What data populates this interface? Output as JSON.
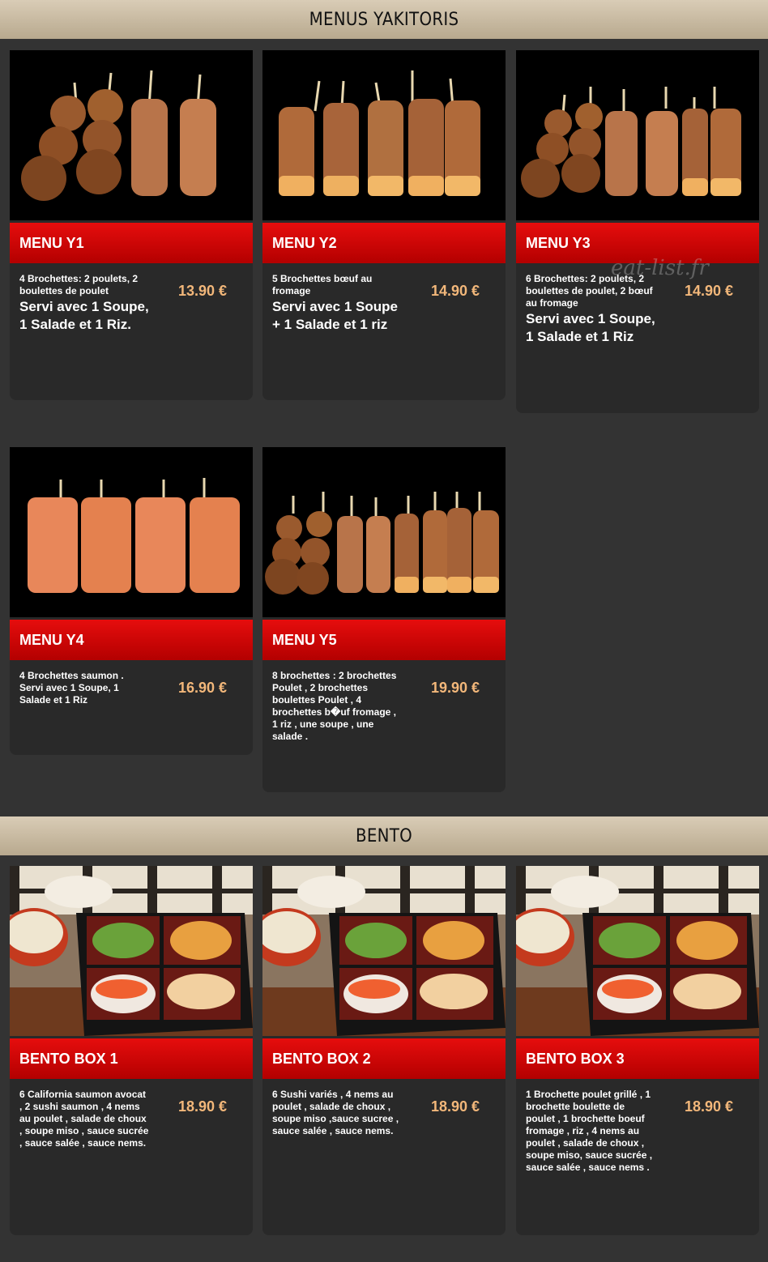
{
  "sections": [
    {
      "title": "MENUS YAKITORIS",
      "items": [
        {
          "title": "MENU Y1",
          "desc": "4 Brochettes: 2 poulets, 2 boulettes de poulet",
          "desc2": "Servi avec 1 Soupe, 1 Salade et 1 Riz.",
          "price": "13.90 €"
        },
        {
          "title": "MENU Y2",
          "desc": "5 Brochettes bœuf au fromage",
          "desc2": "Servi avec 1 Soupe + 1 Salade et 1 riz",
          "price": "14.90 €"
        },
        {
          "title": "MENU Y3",
          "desc": "6 Brochettes: 2 poulets, 2 boulettes de poulet, 2 bœuf au fromage",
          "desc2": "Servi avec 1 Soupe, 1 Salade et 1 Riz",
          "price": "14.90 €"
        },
        {
          "title": "MENU Y4",
          "desc": "4 Brochettes saumon . Servi avec 1 Soupe, 1 Salade et 1 Riz",
          "desc2": "",
          "price": "16.90 €"
        },
        {
          "title": "MENU Y5",
          "desc": "8 brochettes : 2 brochettes Poulet , 2 brochettes boulettes Poulet , 4 brochettes b�uf fromage , 1 riz , une soupe , une salade .",
          "desc2": "",
          "price": "19.90 €"
        }
      ]
    },
    {
      "title": "BENTO",
      "items": [
        {
          "title": "BENTO BOX 1",
          "desc": "6 California saumon avocat , 2 sushi saumon , 4 nems au poulet , salade de choux , soupe miso , sauce sucrée , sauce salée , sauce nems.",
          "desc2": "",
          "price": "18.90 €"
        },
        {
          "title": "BENTO BOX 2",
          "desc": "6 Sushi variés , 4 nems au poulet , salade de choux , soupe miso ,sauce sucree , sauce salée , sauce nems.",
          "desc2": "",
          "price": "18.90 €"
        },
        {
          "title": "BENTO BOX 3",
          "desc": "1 Brochette poulet grillé , 1 brochette boulette de poulet , 1 brochette boeuf fromage , riz , 4 nems au poulet , salade de choux , soupe miso, sauce sucrée , sauce salée , sauce nems .",
          "desc2": "",
          "price": "18.90 €"
        }
      ]
    }
  ],
  "watermark": "eat-list.fr",
  "colors": {
    "header": "#c9bba2",
    "title_bar": "#d40808",
    "price": "#f2b77a",
    "card": "#292929",
    "page": "#333333"
  },
  "icons": [
    "yakitori-photo",
    "bento-photo"
  ]
}
